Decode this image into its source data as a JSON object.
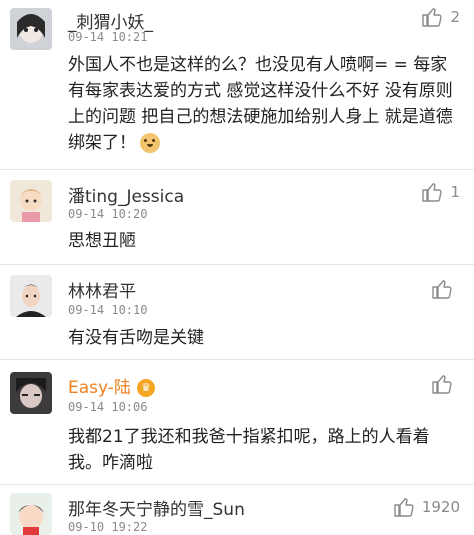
{
  "comments": [
    {
      "name": "_刺猬小妖_",
      "time": "09-14 10:21",
      "text": "外国人不也是这样的么？也没见有人喷啊= = 每家有每家表达爱的方式 感觉这样没什么不好 没有原则上的问题 把自己的想法硬施加给别人身上 就是道德绑架了！",
      "likes": "2",
      "emoji": "doge-emoji"
    },
    {
      "name": "潘ting_Jessica",
      "time": "09-14 10:20",
      "text": "思想丑陋",
      "likes": "1"
    },
    {
      "name": "林林君平",
      "time": "09-14 10:10",
      "text": "有没有舌吻是关键",
      "likes": ""
    },
    {
      "name": "Easy-陆",
      "time": "09-14 10:06",
      "text": "我都21了我还和我爸十指紧扣呢，路上的人看着我。咋滴啦",
      "likes": "",
      "badge": "vip-badge"
    },
    {
      "name": "那年冬天宁静的雪_Sun",
      "time": "09-10 19:22",
      "text": "",
      "likes": "1920"
    }
  ],
  "colors": {
    "name": "#333333",
    "vip_name": "#f08020",
    "time": "#8a8a8a",
    "divider": "#e6e6e6"
  }
}
